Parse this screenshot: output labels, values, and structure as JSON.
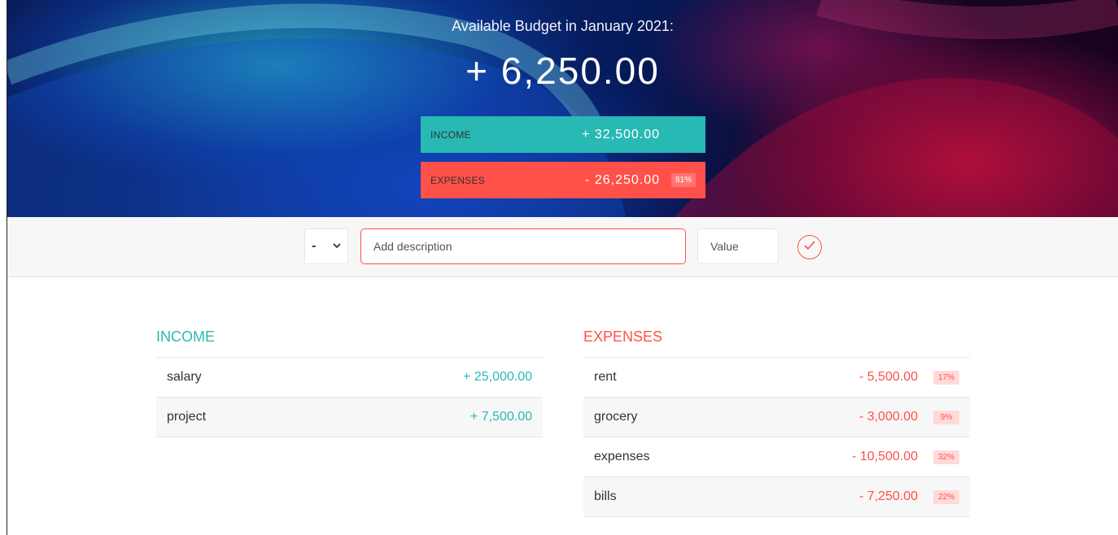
{
  "header": {
    "title": "Available Budget in January 2021:",
    "budget": "+ 6,250.00",
    "income": {
      "label": "INCOME",
      "value": "+ 32,500.00"
    },
    "expenses": {
      "label": "EXPENSES",
      "value": "- 26,250.00",
      "percentage": "81%"
    }
  },
  "add_bar": {
    "type_selected": "-",
    "description_placeholder": "Add description",
    "value_placeholder": "Value",
    "submit_icon": "checkmark-circle-icon"
  },
  "income": {
    "title": "INCOME",
    "items": [
      {
        "description": "salary",
        "value": "+ 25,000.00"
      },
      {
        "description": "project",
        "value": "+ 7,500.00"
      }
    ]
  },
  "expenses": {
    "title": "EXPENSES",
    "items": [
      {
        "description": "rent",
        "value": "- 5,500.00",
        "percentage": "17%"
      },
      {
        "description": "grocery",
        "value": "- 3,000.00",
        "percentage": "9%"
      },
      {
        "description": "expenses",
        "value": "- 10,500.00",
        "percentage": "32%"
      },
      {
        "description": "bills",
        "value": "- 7,250.00",
        "percentage": "22%"
      }
    ]
  },
  "colors": {
    "income": "#28B9B5",
    "expenses": "#FF5049"
  }
}
